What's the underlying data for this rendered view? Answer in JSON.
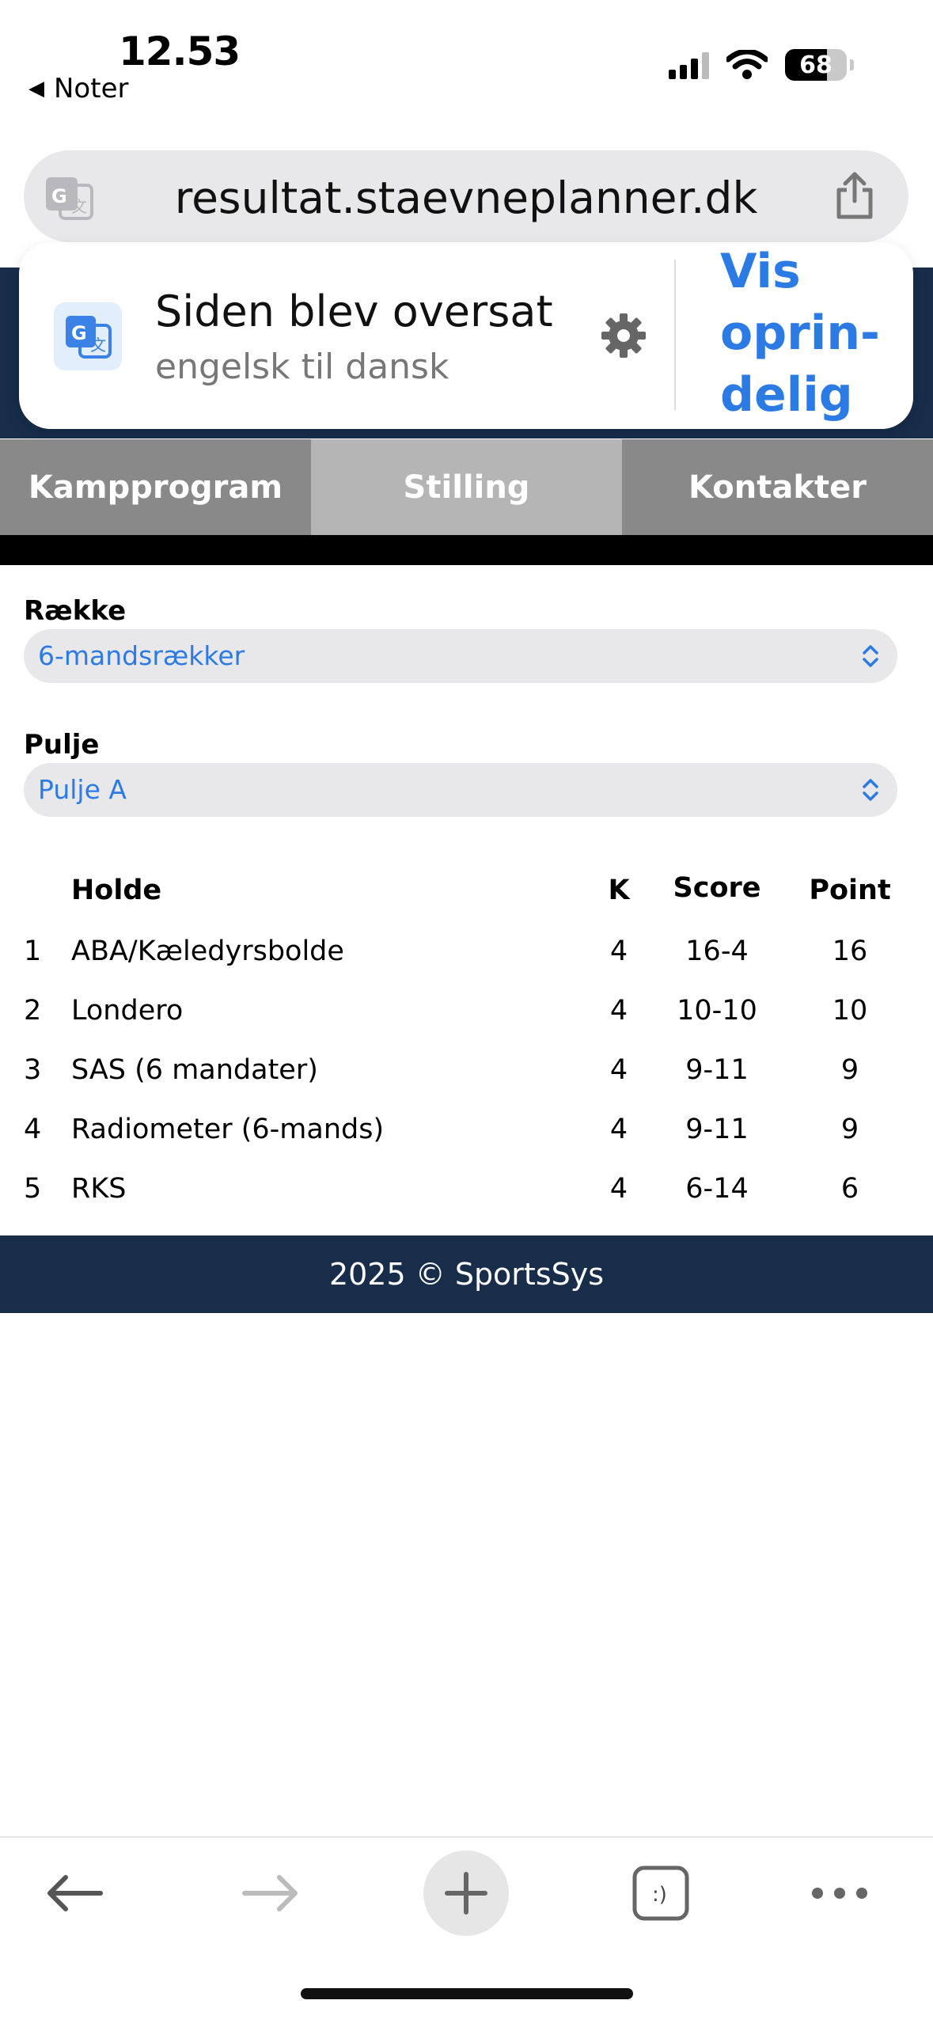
{
  "status_bar": {
    "time": "12.53",
    "back_app": "Noter",
    "battery": "68",
    "battery_level": 0.68
  },
  "browser": {
    "url": "resultat.staevneplanner.dk"
  },
  "translate_popup": {
    "title": "Siden blev oversat",
    "subtitle": "engelsk til dansk",
    "action_line1": "Vis",
    "action_line2": "oprin-",
    "action_line3": "delig"
  },
  "tabs": [
    {
      "label": "Kampprogram",
      "active": false
    },
    {
      "label": "Stilling",
      "active": true
    },
    {
      "label": "Kontakter",
      "active": false
    }
  ],
  "form": {
    "row_label": "Række",
    "row_value": "6-mandsrækker",
    "pool_label": "Pulje",
    "pool_value": "Pulje A"
  },
  "standings": {
    "headers": {
      "team": "Holde",
      "k": "K",
      "score": "Score",
      "point": "Point"
    },
    "rows": [
      {
        "rank": "1",
        "team": "ABA/Kæledyrsbolde",
        "k": "4",
        "score": "16-4",
        "point": "16"
      },
      {
        "rank": "2",
        "team": "Londero",
        "k": "4",
        "score": "10-10",
        "point": "10"
      },
      {
        "rank": "3",
        "team": "SAS (6 mandater)",
        "k": "4",
        "score": "9-11",
        "point": "9"
      },
      {
        "rank": "4",
        "team": "Radiometer (6-mands)",
        "k": "4",
        "score": "9-11",
        "point": "9"
      },
      {
        "rank": "5",
        "team": "RKS",
        "k": "4",
        "score": "6-14",
        "point": "6"
      }
    ]
  },
  "footer": {
    "text": "2025 © SportsSys"
  },
  "toolbar": {
    "tabs_icon_text": ":)"
  },
  "colors": {
    "accent": "#2c7be5",
    "header_dark": "#172d4a",
    "tab_gray": "#898989",
    "tab_active": "#b5b5b5"
  },
  "icons": [
    "back-arrow-icon",
    "forward-arrow-icon",
    "plus-icon",
    "tabs-icon",
    "more-icon",
    "share-icon",
    "translate-icon",
    "gear-icon",
    "wifi-icon",
    "signal-icon",
    "battery-icon",
    "chevron-updown-icon"
  ]
}
